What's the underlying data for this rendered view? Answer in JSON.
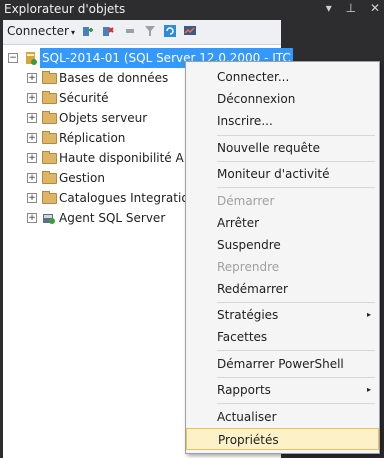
{
  "window": {
    "title": "Explorateur d'objets",
    "pin_icon": "↕",
    "close_icon": "✕"
  },
  "toolbar": {
    "connect_label": "Connecter",
    "caret": "▾"
  },
  "tree": {
    "server": {
      "label": "SQL-2014-01 (SQL Server 12.0.2000 - ITC"
    },
    "items": [
      {
        "label": "Bases de données"
      },
      {
        "label": "Sécurité"
      },
      {
        "label": "Objets serveur"
      },
      {
        "label": "Réplication"
      },
      {
        "label": "Haute disponibilité A"
      },
      {
        "label": "Gestion"
      },
      {
        "label": "Catalogues Integratio"
      },
      {
        "label": "Agent SQL Server"
      }
    ]
  },
  "context_menu": {
    "items": [
      {
        "label": "Connecter..."
      },
      {
        "label": "Déconnexion"
      },
      {
        "label": "Inscrire..."
      },
      {
        "label": "Nouvelle requête"
      },
      {
        "label": "Moniteur d'activité"
      },
      {
        "label": "Démarrer"
      },
      {
        "label": "Arrêter"
      },
      {
        "label": "Suspendre"
      },
      {
        "label": "Reprendre"
      },
      {
        "label": "Redémarrer"
      },
      {
        "label": "Stratégies"
      },
      {
        "label": "Facettes"
      },
      {
        "label": "Démarrer PowerShell"
      },
      {
        "label": "Rapports"
      },
      {
        "label": "Actualiser"
      },
      {
        "label": "Propriétés"
      }
    ],
    "submenu_arrow": "▸"
  },
  "colors": {
    "selection": "#3399ff",
    "highlight": "#fdf2c7",
    "titlebar": "#2d2d30"
  }
}
